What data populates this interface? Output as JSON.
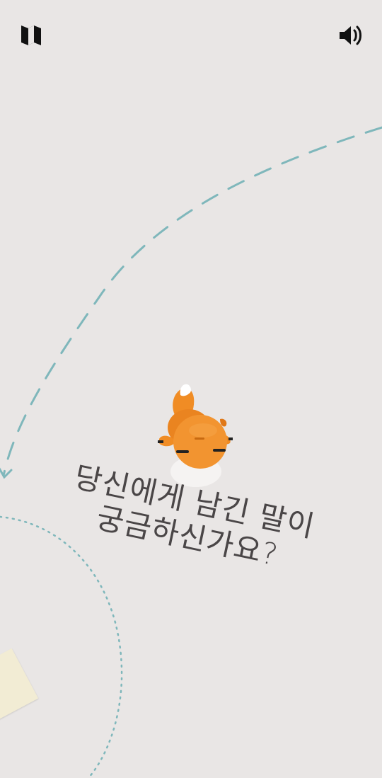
{
  "header": {
    "map_icon": "map-icon",
    "sound_icon": "speaker-volume-icon"
  },
  "prompt": {
    "line1": "당신에게 남긴 말이",
    "line2": "궁금하신가요?"
  },
  "colors": {
    "background": "#e9e6e5",
    "path_dash": "#7fb7bb",
    "fox_orange": "#f08c24",
    "text": "#4a4647",
    "note_paper": "#f2ecd4"
  }
}
